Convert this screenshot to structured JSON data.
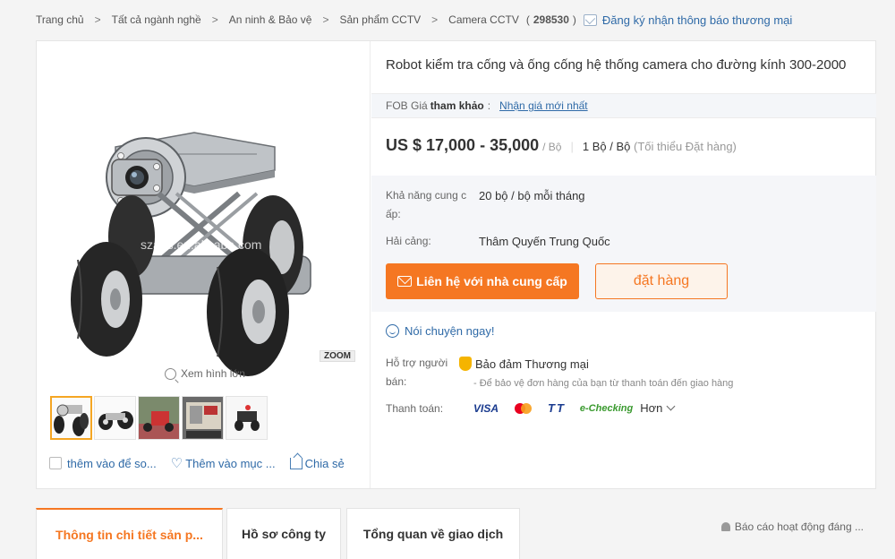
{
  "breadcrumb": {
    "items": [
      "Trang chủ",
      "Tất cả ngành nghề",
      "An ninh & Bảo vệ",
      "Sản phẩm CCTV",
      "Camera CCTV"
    ],
    "separator": ">",
    "count_open": "(",
    "count": "298530",
    "count_close": ")",
    "subscribe": "Đăng ký nhận thông báo thương mại"
  },
  "gallery": {
    "watermark": "szans.en.alibaba.com",
    "zoom_badge": "ZOOM",
    "enlarge": "Xem hình lớn",
    "thumbnail_count": 5,
    "compare": "thêm vào để so...",
    "favorite": "Thêm vào mục ...",
    "share": "Chia sẻ"
  },
  "product": {
    "title": "Robot kiểm tra cống và ống cống hệ thống camera cho đường kính 300-2000",
    "fob_label": "FOB Giá",
    "fob_ref": "tham khảo",
    "fob_colon": ":",
    "fob_link": "Nhận giá mới nhất",
    "price": "US $ 17,000 - 35,000",
    "price_unit": "/ Bộ",
    "divider": "|",
    "moq_value": "1 Bộ / Bộ",
    "moq_note": "(Tối thiểu Đặt hàng)"
  },
  "details": {
    "supply_label_1": "Khả năng cung c",
    "supply_label_2": "ấp:",
    "supply_value": "20 bộ / bộ mỗi tháng",
    "port_label": "Hải cảng:",
    "port_value": "Thâm Quyến Trung Quốc",
    "contact_button": "Liên hệ với nhà cung cấp",
    "order_button": "đặt hàng"
  },
  "chat": {
    "label": "Nói chuyện ngay!"
  },
  "support": {
    "label_1": "Hỗ trợ người",
    "label_2": "bán:",
    "assurance": "Bảo đảm Thương mại",
    "note": "- Để bảo vệ đơn hàng của bạn từ thanh toán đến giao hàng"
  },
  "payment": {
    "label": "Thanh toán:",
    "methods": [
      "VISA",
      "mastercard",
      "TT",
      "e-Checking"
    ],
    "visa": "VISA",
    "tt": "TT",
    "echecking": "e-Checking",
    "more": "Hơn"
  },
  "tabs": [
    "Thông tin chi tiết sản p...",
    "Hồ sơ công ty",
    "Tổng quan về giao dịch"
  ],
  "report": "Báo cáo hoạt động đáng ...",
  "colors": {
    "accent": "#f57722",
    "link": "#2f6aa7",
    "ecCheck": "#3a9a2f"
  }
}
